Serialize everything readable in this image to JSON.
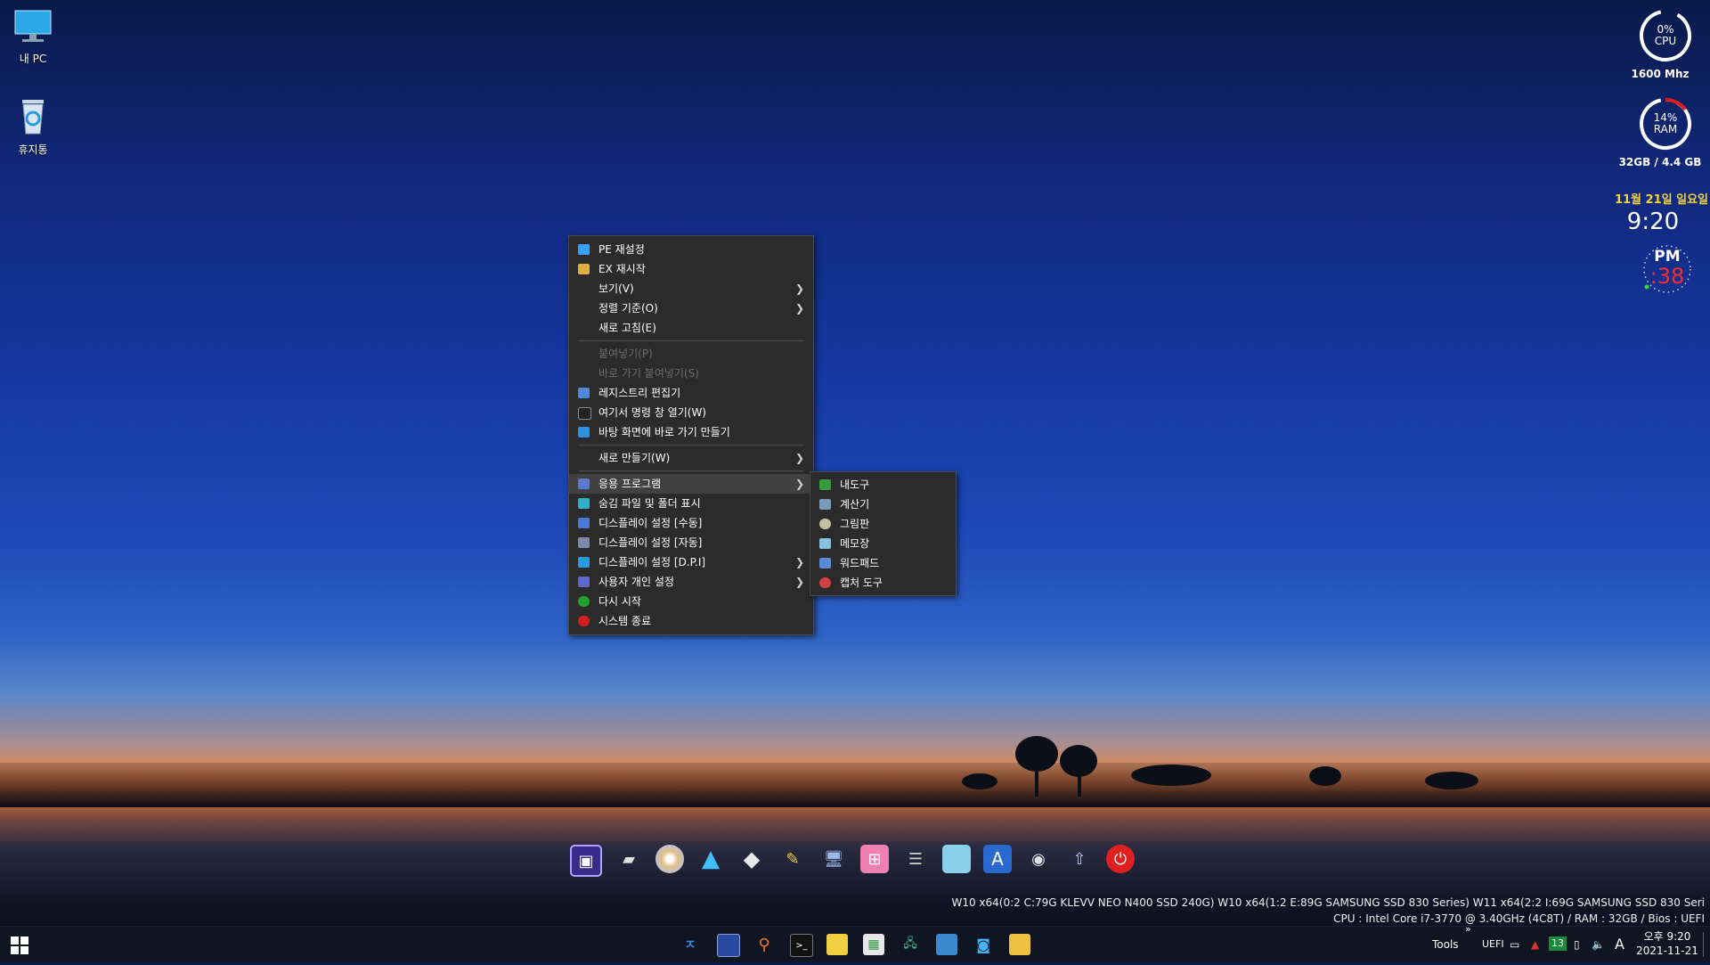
{
  "desktop": {
    "icons": [
      {
        "label": "내 PC",
        "icon": "monitor-icon"
      },
      {
        "label": "휴지통",
        "icon": "recycle-bin-icon"
      }
    ]
  },
  "widgets": {
    "cpu": {
      "percent_text": "0%",
      "label": "CPU",
      "percent": 0,
      "sub": "1600 Mhz"
    },
    "ram": {
      "percent_text": "14%",
      "label": "RAM",
      "percent": 14,
      "sub": "32GB / 4.4 GB"
    },
    "date": "11월 21일 일요일",
    "time": "9:20",
    "ampm": "PM",
    "seconds": ":38"
  },
  "context_menu": {
    "items": [
      {
        "label": "PE 재설정",
        "icon": "refresh-icon",
        "color": "#3aa0ff"
      },
      {
        "label": "EX 재시작",
        "icon": "explorer-icon",
        "color": "#e0b040"
      },
      {
        "label": "보기(V)",
        "submenu": true
      },
      {
        "label": "정렬 기준(O)",
        "submenu": true
      },
      {
        "label": "새로 고침(E)"
      },
      {
        "label": "붙여넣기(P)",
        "disabled": true
      },
      {
        "label": "바로 가기 붙여넣기(S)",
        "disabled": true
      },
      {
        "label": "레지스트리 편집기",
        "icon": "registry-icon",
        "color": "#4a8ad8"
      },
      {
        "label": "여기서 명령 창 열기(W)",
        "icon": "console-icon",
        "color": "#222222"
      },
      {
        "label": "바탕 화면에 바로 가기 만들기",
        "icon": "shortcut-icon",
        "color": "#2d8fe0"
      },
      {
        "label": "새로 만들기(W)",
        "submenu": true
      },
      {
        "label": "응용 프로그램",
        "icon": "apps-icon",
        "color": "#5a7ad0",
        "submenu": true
      },
      {
        "label": "숨김 파일 및 폴더 표시",
        "icon": "hidden-files-icon",
        "color": "#2fb0d0"
      },
      {
        "label": "디스플레이 설정 [수동]",
        "icon": "display-icon",
        "color": "#4a7ad8"
      },
      {
        "label": "디스플레이 설정 [자동]",
        "icon": "display-auto-icon",
        "color": "#7a8aa8"
      },
      {
        "label": "디스플레이 설정 [D.P.I]",
        "icon": "dpi-icon",
        "color": "#2a9ae0",
        "submenu": true
      },
      {
        "label": "사용자 개인 설정",
        "icon": "personalize-icon",
        "color": "#5a6ad0",
        "submenu": true
      },
      {
        "label": "다시 시작",
        "icon": "restart-icon",
        "color": "#22a030"
      },
      {
        "label": "시스템 종료",
        "icon": "power-icon",
        "color": "#d02020"
      }
    ]
  },
  "submenu": {
    "items": [
      {
        "label": "내도구",
        "icon": "tools-icon",
        "color": "#3a9a40"
      },
      {
        "label": "계산기",
        "icon": "calculator-icon",
        "color": "#7a9ab8"
      },
      {
        "label": "그림판",
        "icon": "paint-icon",
        "color": "#c0c0a0"
      },
      {
        "label": "메모장",
        "icon": "notepad-icon",
        "color": "#8ac0e0"
      },
      {
        "label": "워드패드",
        "icon": "wordpad-icon",
        "color": "#5a8ad0"
      },
      {
        "label": "캡처 도구",
        "icon": "snipping-icon",
        "color": "#d04040"
      }
    ]
  },
  "dock": {
    "icons": [
      "chip-icon",
      "usb-drive-icon",
      "disc-icon",
      "triangle-icon",
      "diamond-icon",
      "edit-tool-icon",
      "network-pc-icon",
      "windows-store-icon",
      "disk-tool-icon",
      "document-icon",
      "font-icon",
      "camera-tool-icon",
      "rocket-icon",
      "power-button-icon"
    ]
  },
  "info": {
    "line1": "W10  x64(0:2 C:79G KLEVV NEO N400 SSD 240G) W10  x64(1:2 E:89G SAMSUNG SSD 830 Series) W11  x64(2:2 I:69G SAMSUNG SSD 830 Seri",
    "line2": "CPU : Intel Core i7-3770 @ 3.40GHz (4C8T) / RAM : 32GB / Bios : UEFI"
  },
  "taskbar": {
    "start_icon": "windows-start-icon",
    "apps": [
      "app-launcher-icon",
      "floppy-save-icon",
      "search-icon",
      "terminal-icon",
      "notes-icon",
      "registry-tool-icon",
      "network-icon",
      "explorer-window-icon",
      "camera-icon",
      "folder-icon"
    ],
    "tools_label": "Tools",
    "uefi_label": "UEFI",
    "badge": "13",
    "ime": "A",
    "time": "오후 9:20",
    "date": "2021-11-21"
  }
}
